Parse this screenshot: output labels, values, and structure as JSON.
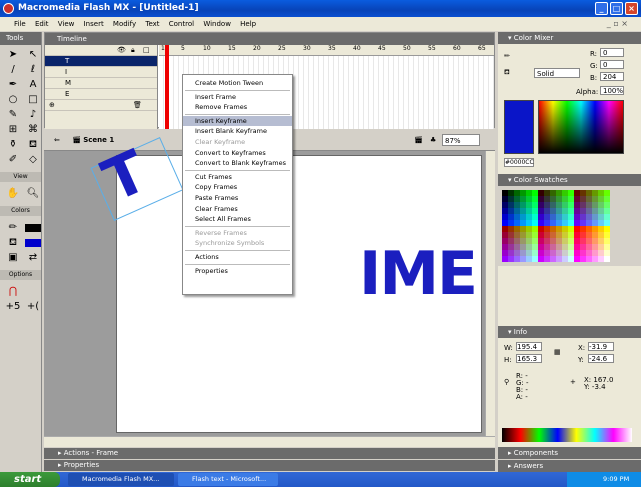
{
  "window": {
    "title": "Macromedia Flash MX - [Untitled-1]"
  },
  "menubar": [
    "File",
    "Edit",
    "View",
    "Insert",
    "Modify",
    "Text",
    "Control",
    "Window",
    "Help"
  ],
  "tools": {
    "title": "Tools",
    "view_label": "View",
    "colors_label": "Colors",
    "options_label": "Options"
  },
  "timeline": {
    "title": "Timeline",
    "layers": [
      "T",
      "I",
      "M",
      "E"
    ],
    "ruler": [
      "1",
      "5",
      "10",
      "15",
      "20",
      "25",
      "30",
      "35",
      "40",
      "45",
      "50",
      "55",
      "60",
      "65"
    ]
  },
  "editbar": {
    "scene": "Scene 1",
    "zoom": "87%"
  },
  "stage": {
    "letters": "IME",
    "rotated_letter": "T"
  },
  "context_menu": {
    "group1": [
      "Create Motion Tween"
    ],
    "group2": [
      "Insert Frame",
      "Remove Frames"
    ],
    "group3": [
      "Insert Keyframe",
      "Insert Blank Keyframe",
      "Clear Keyframe",
      "Convert to Keyframes",
      "Convert to Blank Keyframes"
    ],
    "group4": [
      "Cut Frames",
      "Copy Frames",
      "Paste Frames",
      "Clear Frames",
      "Select All Frames"
    ],
    "group5": [
      "Reverse Frames",
      "Synchronize Symbols"
    ],
    "group6": [
      "Actions"
    ],
    "group7": [
      "Properties"
    ],
    "highlighted": "Insert Keyframe"
  },
  "bottom_panels": {
    "actions": "Actions - Frame",
    "properties": "Properties"
  },
  "color_mixer": {
    "title": "Color Mixer",
    "fill_type": "Solid",
    "r": "0",
    "g": "0",
    "b": "204",
    "alpha": "100%",
    "hex": "#0000CC",
    "accent": "#0000cc"
  },
  "swatches": {
    "title": "Color Swatches"
  },
  "info": {
    "title": "Info",
    "w": "195.4",
    "h": "165.3",
    "x": "-31.9",
    "y": "-24.6",
    "r": "R: -",
    "g": "G: -",
    "b": "B: -",
    "a": "A: -",
    "cx": "X: 167.0",
    "cy": "Y: -3.4"
  },
  "right_bottom": {
    "components": "Components",
    "answers": "Answers"
  },
  "taskbar": {
    "start": "start",
    "task1": "Macromedia Flash MX...",
    "task2": "Flash text - Microsoft...",
    "time": "9:09 PM"
  }
}
